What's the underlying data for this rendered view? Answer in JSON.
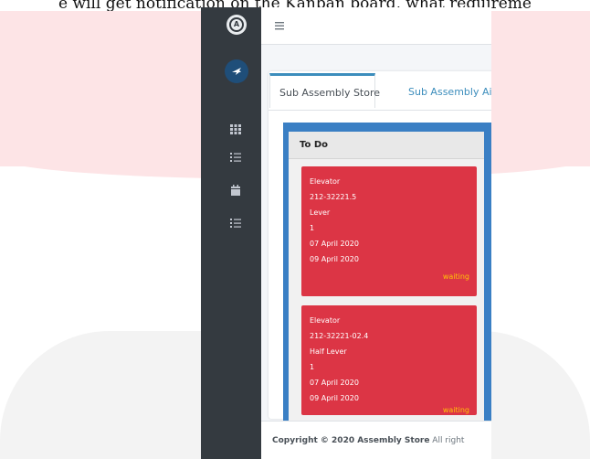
{
  "caption": "e will get notification on the Kanban board, what requireme",
  "sidebar": {
    "logo_letter": "A",
    "icons": [
      "apps-grid-icon",
      "list-icon",
      "calendar-icon",
      "list-icon"
    ]
  },
  "tabs": [
    {
      "label": "Sub Assembly Store"
    },
    {
      "label": "Sub Assembly Ai"
    }
  ],
  "board": {
    "column_title": "To Do",
    "tasks": [
      {
        "name": "Elevator",
        "code": "212-32221.5",
        "part": "Lever",
        "qty": "1",
        "date1": "07 April 2020",
        "date2": "09 April 2020",
        "status": "waiting"
      },
      {
        "name": "Elevator",
        "code": "212-32221-02.4",
        "part": "Half Lever",
        "qty": "1",
        "date1": "07 April 2020",
        "date2": "09 April 2020",
        "status": "waiting"
      }
    ]
  },
  "footer": {
    "prefix": "Copyright © 2020 Assembly Store",
    "suffix": " All right"
  },
  "colors": {
    "sidebar": "#343a40",
    "task_card": "#dc3545",
    "status_text": "#ffc107",
    "board_bg": "#3a7fc4",
    "accent": "#3c8dbc"
  }
}
